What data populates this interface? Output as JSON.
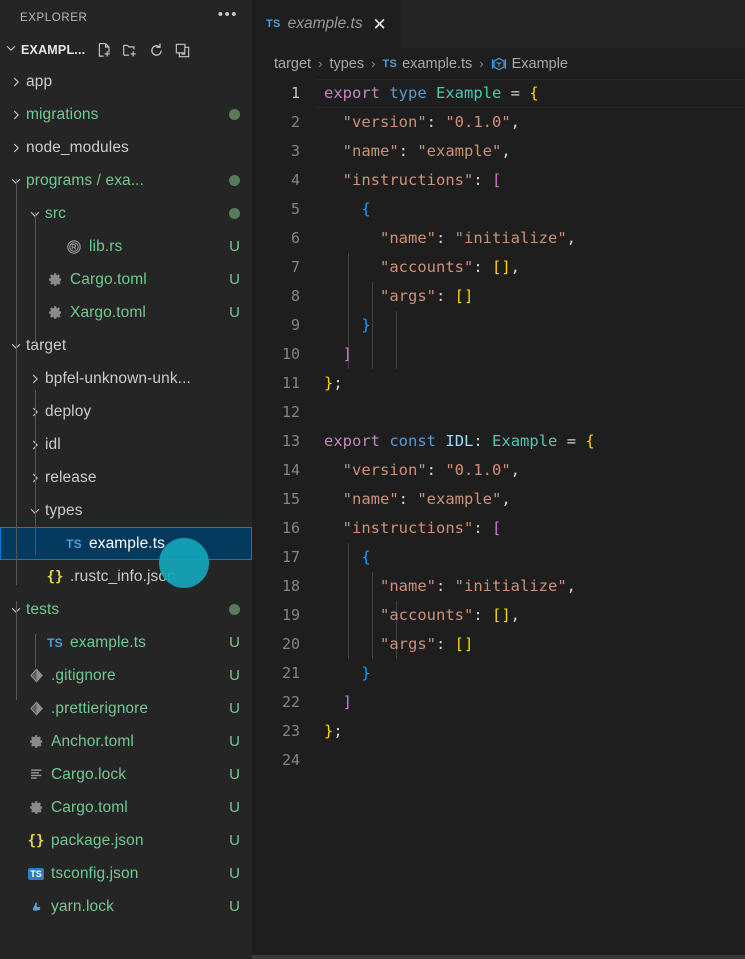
{
  "sidebar": {
    "title": "EXPLORER",
    "more_actions": "•••",
    "root": {
      "label": "EXAMPL...",
      "actions": [
        {
          "name": "new-file",
          "tooltip": "New File"
        },
        {
          "name": "new-folder",
          "tooltip": "New Folder"
        },
        {
          "name": "refresh",
          "tooltip": "Refresh Explorer"
        },
        {
          "name": "collapse-all",
          "tooltip": "Collapse Folders in Explorer"
        }
      ]
    },
    "items": [
      {
        "label": "app",
        "kind": "folder",
        "icon": "chevron-right-icon",
        "expanded": false,
        "depth": 1,
        "color": "gray",
        "badge": "",
        "dot": false,
        "selected": false
      },
      {
        "label": "migrations",
        "kind": "folder",
        "icon": "chevron-right-icon",
        "expanded": false,
        "depth": 1,
        "color": "green",
        "badge": "",
        "dot": true,
        "selected": false
      },
      {
        "label": "node_modules",
        "kind": "folder",
        "icon": "chevron-right-icon",
        "expanded": false,
        "depth": 1,
        "color": "gray",
        "badge": "",
        "dot": false,
        "selected": false
      },
      {
        "label": "programs / exa...",
        "kind": "folder",
        "icon": "chevron-down-icon",
        "expanded": true,
        "depth": 1,
        "color": "green",
        "badge": "",
        "dot": true,
        "selected": false
      },
      {
        "label": "src",
        "kind": "folder",
        "icon": "chevron-down-icon",
        "expanded": true,
        "depth": 2,
        "color": "green",
        "badge": "",
        "dot": true,
        "selected": false
      },
      {
        "label": "lib.rs",
        "kind": "file",
        "icon": "rust-icon",
        "depth": 3,
        "color": "green",
        "badge": "U",
        "dot": false,
        "selected": false
      },
      {
        "label": "Cargo.toml",
        "kind": "file",
        "icon": "gear-icon",
        "depth": 2,
        "color": "green",
        "badge": "U",
        "dot": false,
        "selected": false
      },
      {
        "label": "Xargo.toml",
        "kind": "file",
        "icon": "gear-icon",
        "depth": 2,
        "color": "green",
        "badge": "U",
        "dot": false,
        "selected": false
      },
      {
        "label": "target",
        "kind": "folder",
        "icon": "chevron-down-icon",
        "expanded": true,
        "depth": 1,
        "color": "gray",
        "badge": "",
        "dot": false,
        "selected": false
      },
      {
        "label": "bpfel-unknown-unk...",
        "kind": "folder",
        "icon": "chevron-right-icon",
        "expanded": false,
        "depth": 2,
        "color": "gray",
        "badge": "",
        "dot": false,
        "selected": false
      },
      {
        "label": "deploy",
        "kind": "folder",
        "icon": "chevron-right-icon",
        "expanded": false,
        "depth": 2,
        "color": "gray",
        "badge": "",
        "dot": false,
        "selected": false
      },
      {
        "label": "idl",
        "kind": "folder",
        "icon": "chevron-right-icon",
        "expanded": false,
        "depth": 2,
        "color": "gray",
        "badge": "",
        "dot": false,
        "selected": false
      },
      {
        "label": "release",
        "kind": "folder",
        "icon": "chevron-right-icon",
        "expanded": false,
        "depth": 2,
        "color": "gray",
        "badge": "",
        "dot": false,
        "selected": false
      },
      {
        "label": "types",
        "kind": "folder",
        "icon": "chevron-down-icon",
        "expanded": true,
        "depth": 2,
        "color": "gray",
        "badge": "",
        "dot": false,
        "selected": false
      },
      {
        "label": "example.ts",
        "kind": "file",
        "icon": "typescript-icon",
        "depth": 3,
        "color": "white",
        "badge": "",
        "dot": false,
        "selected": true
      },
      {
        "label": ".rustc_info.json",
        "kind": "file",
        "icon": "json-icon",
        "depth": 2,
        "color": "gray",
        "badge": "",
        "dot": false,
        "selected": false
      },
      {
        "label": "tests",
        "kind": "folder",
        "icon": "chevron-down-icon",
        "expanded": true,
        "depth": 1,
        "color": "green",
        "badge": "",
        "dot": true,
        "selected": false
      },
      {
        "label": "example.ts",
        "kind": "file",
        "icon": "typescript-icon",
        "depth": 2,
        "color": "green",
        "badge": "U",
        "dot": false,
        "selected": false
      },
      {
        "label": ".gitignore",
        "kind": "file",
        "icon": "git-icon",
        "depth": 1,
        "color": "green",
        "badge": "U",
        "dot": false,
        "selected": false
      },
      {
        "label": ".prettierignore",
        "kind": "file",
        "icon": "git-icon",
        "depth": 1,
        "color": "green",
        "badge": "U",
        "dot": false,
        "selected": false
      },
      {
        "label": "Anchor.toml",
        "kind": "file",
        "icon": "gear-icon",
        "depth": 1,
        "color": "green",
        "badge": "U",
        "dot": false,
        "selected": false
      },
      {
        "label": "Cargo.lock",
        "kind": "file",
        "icon": "lock-list-icon",
        "depth": 1,
        "color": "green",
        "badge": "U",
        "dot": false,
        "selected": false
      },
      {
        "label": "Cargo.toml",
        "kind": "file",
        "icon": "gear-icon",
        "depth": 1,
        "color": "green",
        "badge": "U",
        "dot": false,
        "selected": false
      },
      {
        "label": "package.json",
        "kind": "file",
        "icon": "json-icon",
        "depth": 1,
        "color": "green",
        "badge": "U",
        "dot": false,
        "selected": false
      },
      {
        "label": "tsconfig.json",
        "kind": "file",
        "icon": "tsconfig-icon",
        "depth": 1,
        "color": "green",
        "badge": "U",
        "dot": false,
        "selected": false
      },
      {
        "label": "yarn.lock",
        "kind": "file",
        "icon": "yarn-icon",
        "depth": 1,
        "color": "green",
        "badge": "U",
        "dot": false,
        "selected": false
      }
    ]
  },
  "editor": {
    "tab": {
      "badge": "TS",
      "name": "example.ts",
      "close": "✕",
      "preview": true
    },
    "breadcrumb": [
      {
        "label": "target",
        "icon": ""
      },
      {
        "label": "types",
        "icon": ""
      },
      {
        "label": "example.ts",
        "icon": "typescript-icon"
      },
      {
        "label": "Example",
        "icon": "symbol-interface-icon"
      }
    ],
    "breadcrumb_separator": "›",
    "language": "TypeScript",
    "active_line": 1,
    "lines": [
      {
        "n": "1",
        "tokens": [
          {
            "t": "export",
            "c": "t-kw"
          },
          {
            "t": " ",
            "c": "t-pun"
          },
          {
            "t": "type",
            "c": "t-kw2"
          },
          {
            "t": " ",
            "c": "t-pun"
          },
          {
            "t": "Example",
            "c": "t-type"
          },
          {
            "t": " = ",
            "c": "t-pun"
          },
          {
            "t": "{",
            "c": "b1"
          }
        ]
      },
      {
        "n": "2",
        "tokens": [
          {
            "t": "  ",
            "c": "t-pun"
          },
          {
            "t": "\"version\"",
            "c": "t-str"
          },
          {
            "t": ": ",
            "c": "t-pun"
          },
          {
            "t": "\"0.1.0\"",
            "c": "t-str"
          },
          {
            "t": ",",
            "c": "t-pun"
          }
        ]
      },
      {
        "n": "3",
        "tokens": [
          {
            "t": "  ",
            "c": "t-pun"
          },
          {
            "t": "\"name\"",
            "c": "t-str"
          },
          {
            "t": ": ",
            "c": "t-pun"
          },
          {
            "t": "\"example\"",
            "c": "t-str"
          },
          {
            "t": ",",
            "c": "t-pun"
          }
        ]
      },
      {
        "n": "4",
        "tokens": [
          {
            "t": "  ",
            "c": "t-pun"
          },
          {
            "t": "\"instructions\"",
            "c": "t-str"
          },
          {
            "t": ": ",
            "c": "t-pun"
          },
          {
            "t": "[",
            "c": "b2"
          }
        ]
      },
      {
        "n": "5",
        "tokens": [
          {
            "t": "    ",
            "c": "t-pun"
          },
          {
            "t": "{",
            "c": "b3"
          }
        ]
      },
      {
        "n": "6",
        "tokens": [
          {
            "t": "      ",
            "c": "t-pun"
          },
          {
            "t": "\"name\"",
            "c": "t-str"
          },
          {
            "t": ": ",
            "c": "t-pun"
          },
          {
            "t": "\"initialize\"",
            "c": "t-str"
          },
          {
            "t": ",",
            "c": "t-pun"
          }
        ]
      },
      {
        "n": "7",
        "tokens": [
          {
            "t": "      ",
            "c": "t-pun"
          },
          {
            "t": "\"accounts\"",
            "c": "t-str"
          },
          {
            "t": ": ",
            "c": "t-pun"
          },
          {
            "t": "[]",
            "c": "b1"
          },
          {
            "t": ",",
            "c": "t-pun"
          }
        ]
      },
      {
        "n": "8",
        "tokens": [
          {
            "t": "      ",
            "c": "t-pun"
          },
          {
            "t": "\"args\"",
            "c": "t-str"
          },
          {
            "t": ": ",
            "c": "t-pun"
          },
          {
            "t": "[]",
            "c": "b1"
          }
        ]
      },
      {
        "n": "9",
        "tokens": [
          {
            "t": "    ",
            "c": "t-pun"
          },
          {
            "t": "}",
            "c": "b3"
          }
        ]
      },
      {
        "n": "10",
        "tokens": [
          {
            "t": "  ",
            "c": "t-pun"
          },
          {
            "t": "]",
            "c": "b2"
          }
        ]
      },
      {
        "n": "11",
        "tokens": [
          {
            "t": "}",
            "c": "b1"
          },
          {
            "t": ";",
            "c": "t-pun"
          }
        ]
      },
      {
        "n": "12",
        "tokens": []
      },
      {
        "n": "13",
        "tokens": [
          {
            "t": "export",
            "c": "t-kw"
          },
          {
            "t": " ",
            "c": "t-pun"
          },
          {
            "t": "const",
            "c": "t-kw2"
          },
          {
            "t": " ",
            "c": "t-pun"
          },
          {
            "t": "IDL",
            "c": "t-var"
          },
          {
            "t": ": ",
            "c": "t-pun"
          },
          {
            "t": "Example",
            "c": "t-type"
          },
          {
            "t": " = ",
            "c": "t-pun"
          },
          {
            "t": "{",
            "c": "b1"
          }
        ]
      },
      {
        "n": "14",
        "tokens": [
          {
            "t": "  ",
            "c": "t-pun"
          },
          {
            "t": "\"version\"",
            "c": "t-str"
          },
          {
            "t": ": ",
            "c": "t-pun"
          },
          {
            "t": "\"0.1.0\"",
            "c": "t-str"
          },
          {
            "t": ",",
            "c": "t-pun"
          }
        ]
      },
      {
        "n": "15",
        "tokens": [
          {
            "t": "  ",
            "c": "t-pun"
          },
          {
            "t": "\"name\"",
            "c": "t-str"
          },
          {
            "t": ": ",
            "c": "t-pun"
          },
          {
            "t": "\"example\"",
            "c": "t-str"
          },
          {
            "t": ",",
            "c": "t-pun"
          }
        ]
      },
      {
        "n": "16",
        "tokens": [
          {
            "t": "  ",
            "c": "t-pun"
          },
          {
            "t": "\"instructions\"",
            "c": "t-str"
          },
          {
            "t": ": ",
            "c": "t-pun"
          },
          {
            "t": "[",
            "c": "b2"
          }
        ]
      },
      {
        "n": "17",
        "tokens": [
          {
            "t": "    ",
            "c": "t-pun"
          },
          {
            "t": "{",
            "c": "b3"
          }
        ]
      },
      {
        "n": "18",
        "tokens": [
          {
            "t": "      ",
            "c": "t-pun"
          },
          {
            "t": "\"name\"",
            "c": "t-str"
          },
          {
            "t": ": ",
            "c": "t-pun"
          },
          {
            "t": "\"initialize\"",
            "c": "t-str"
          },
          {
            "t": ",",
            "c": "t-pun"
          }
        ]
      },
      {
        "n": "19",
        "tokens": [
          {
            "t": "      ",
            "c": "t-pun"
          },
          {
            "t": "\"accounts\"",
            "c": "t-str"
          },
          {
            "t": ": ",
            "c": "t-pun"
          },
          {
            "t": "[]",
            "c": "b1"
          },
          {
            "t": ",",
            "c": "t-pun"
          }
        ]
      },
      {
        "n": "20",
        "tokens": [
          {
            "t": "      ",
            "c": "t-pun"
          },
          {
            "t": "\"args\"",
            "c": "t-str"
          },
          {
            "t": ": ",
            "c": "t-pun"
          },
          {
            "t": "[]",
            "c": "b1"
          }
        ]
      },
      {
        "n": "21",
        "tokens": [
          {
            "t": "    ",
            "c": "t-pun"
          },
          {
            "t": "}",
            "c": "b3"
          }
        ]
      },
      {
        "n": "22",
        "tokens": [
          {
            "t": "  ",
            "c": "t-pun"
          },
          {
            "t": "]",
            "c": "b2"
          }
        ]
      },
      {
        "n": "23",
        "tokens": [
          {
            "t": "}",
            "c": "b1"
          },
          {
            "t": ";",
            "c": "t-pun"
          }
        ]
      },
      {
        "n": "24",
        "tokens": []
      }
    ]
  },
  "theme": {
    "editor_bg": "#1E1E1E",
    "sidebar_bg": "#252526",
    "selection_bg": "#04395E",
    "selection_border": "#007FD4",
    "cursor_highlight": "#12A5B8",
    "git_modified_dot": "#587C5A",
    "git_untracked": "#73C991"
  }
}
